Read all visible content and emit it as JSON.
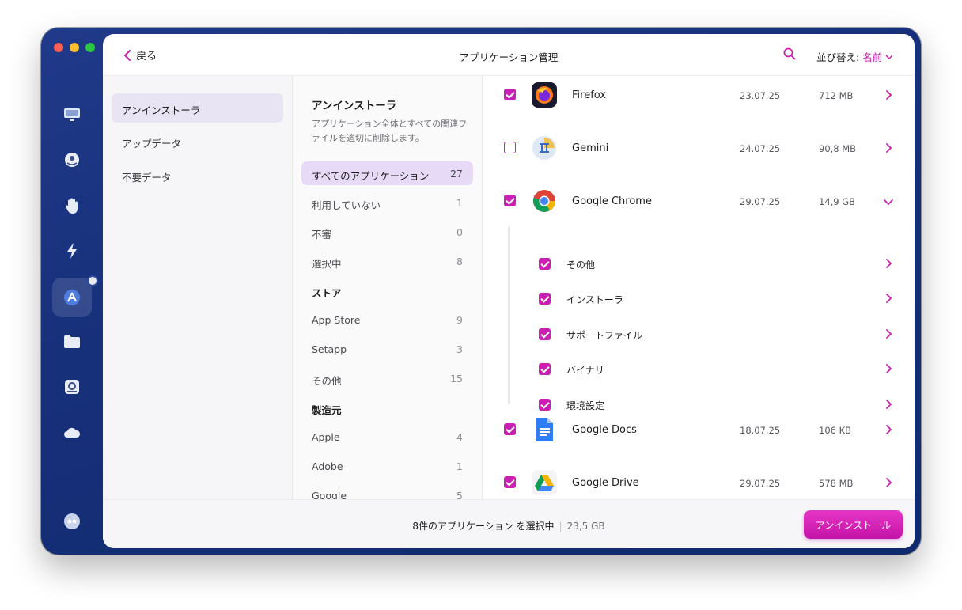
{
  "header": {
    "back_label": "戻る",
    "title": "アプリケーション管理",
    "sort_label": "並び替え:",
    "sort_value": "名前"
  },
  "nav": {
    "items": [
      {
        "label": "アンインストーラ",
        "active": true
      },
      {
        "label": "アップデータ",
        "active": false
      },
      {
        "label": "不要データ",
        "active": false
      }
    ]
  },
  "categories": {
    "heading": "アンインストーラ",
    "description": "アプリケーション全体とすべての関連ファイルを適切に削除します。",
    "all": {
      "label": "すべてのアプリケーション",
      "count": "27"
    },
    "unused": {
      "label": "利用していない",
      "count": "1"
    },
    "suspicious": {
      "label": "不審",
      "count": "0"
    },
    "selected": {
      "label": "選択中",
      "count": "8"
    },
    "store_heading": "ストア",
    "app_store": {
      "label": "App Store",
      "count": "9"
    },
    "setapp": {
      "label": "Setapp",
      "count": "3"
    },
    "other": {
      "label": "その他",
      "count": "15"
    },
    "vendor_heading": "製造元",
    "apple": {
      "label": "Apple",
      "count": "4"
    },
    "adobe": {
      "label": "Adobe",
      "count": "1"
    },
    "google": {
      "label": "Google",
      "count": "5"
    }
  },
  "apps": {
    "firefox": {
      "name": "Firefox",
      "date": "23.07.25",
      "size": "712 MB",
      "checked": true
    },
    "gemini": {
      "name": "Gemini",
      "date": "24.07.25",
      "size": "90,8 MB",
      "checked": false
    },
    "chrome": {
      "name": "Google Chrome",
      "date": "29.07.25",
      "size": "14,9 GB",
      "checked": true,
      "expanded": true
    },
    "docs": {
      "name": "Google Docs",
      "date": "18.07.25",
      "size": "106 KB",
      "checked": true
    },
    "drive": {
      "name": "Google Drive",
      "date": "29.07.25",
      "size": "578 MB",
      "checked": true
    }
  },
  "chrome_subitems": {
    "other": "その他",
    "installer": "インストーラ",
    "support_files": "サポートファイル",
    "binary": "バイナリ",
    "preferences": "環境設定"
  },
  "footer": {
    "selection_text": "8件のアプリケーション を選択中",
    "total_size": "23,5 GB",
    "uninstall_label": "アンインストール"
  },
  "colors": {
    "accent": "#c91fb3",
    "sidebar_bg": "#17307a",
    "active_nav": "#e8e4f3",
    "active_category": "#e6daf7"
  }
}
